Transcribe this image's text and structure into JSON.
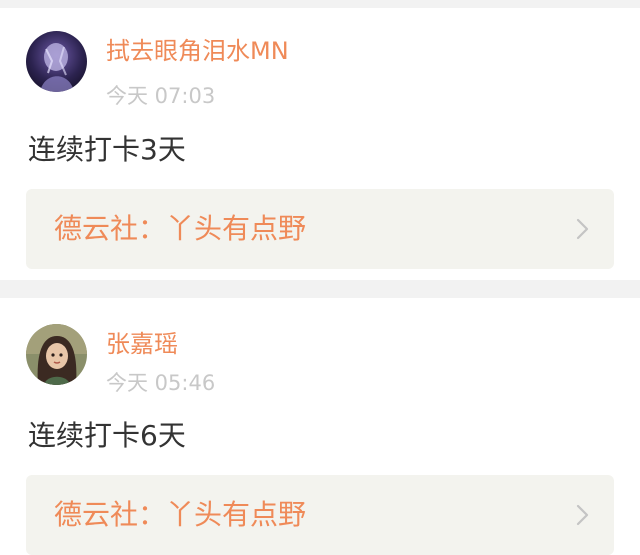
{
  "posts": [
    {
      "username": "拭去眼角泪水MN",
      "timestamp": "今天 07:03",
      "content": "连续打卡3天",
      "link_title": "德云社：丫头有点野",
      "avatar_icon": "avatar-dark-purple-icon"
    },
    {
      "username": "张嘉瑶",
      "timestamp": "今天 05:46",
      "content": "连续打卡6天",
      "link_title": "德云社：丫头有点野",
      "avatar_icon": "avatar-illustrated-girl-icon"
    }
  ],
  "colors": {
    "accent": "#ef8a58",
    "timestamp": "#c8c8c8",
    "text": "#333333",
    "card_bg": "#f3f3ee",
    "divider": "#f2f2f2"
  }
}
